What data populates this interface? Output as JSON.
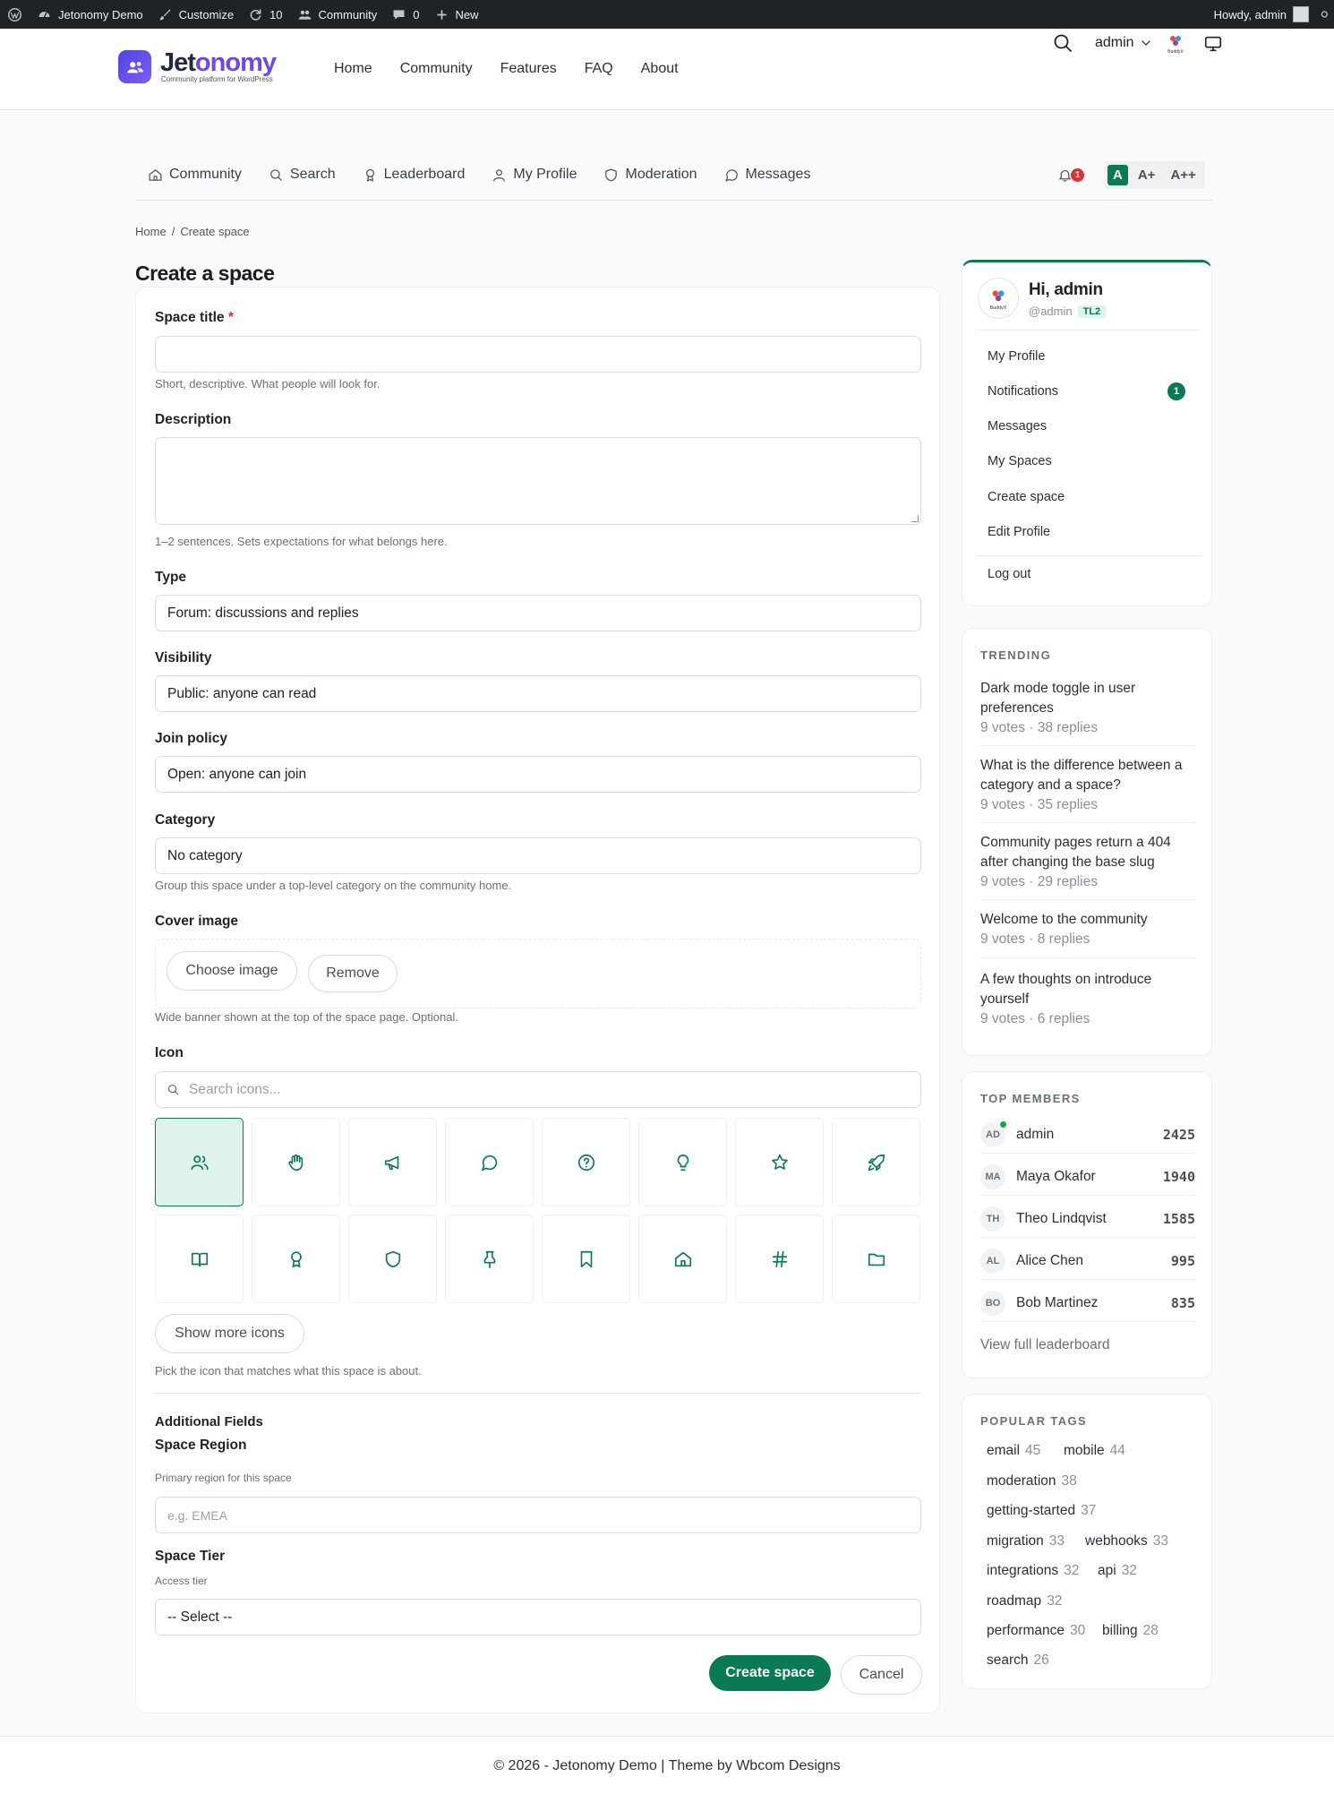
{
  "admin_bar": {
    "site_name": "Jetonomy Demo",
    "customize": "Customize",
    "updates_count": "10",
    "community": "Community",
    "comments_count": "0",
    "new": "New",
    "howdy": "Howdy, admin"
  },
  "header": {
    "logo_name_a": "Jet",
    "logo_name_b": "onomy",
    "logo_tagline": "Community platform for WordPress",
    "nav": [
      "Home",
      "Community",
      "Features",
      "FAQ",
      "About"
    ],
    "user_label": "admin",
    "avatar_label": "BuddyX"
  },
  "community_nav": {
    "items": [
      "Community",
      "Search",
      "Leaderboard",
      "My Profile",
      "Moderation",
      "Messages"
    ],
    "notification_count": "1",
    "font_sizes": [
      "A",
      "A+",
      "A++"
    ]
  },
  "breadcrumb": {
    "home": "Home",
    "sep": "/",
    "current": "Create space"
  },
  "page_title": "Create a space",
  "form": {
    "title_label": "Space title",
    "required_mark": "*",
    "title_value": "",
    "title_help": "Short, descriptive. What people will look for.",
    "description_label": "Description",
    "description_value": "",
    "description_help": "1–2 sentences. Sets expectations for what belongs here.",
    "type_label": "Type",
    "type_value": "Forum: discussions and replies",
    "visibility_label": "Visibility",
    "visibility_value": "Public: anyone can read",
    "join_label": "Join policy",
    "join_value": "Open: anyone can join",
    "category_label": "Category",
    "category_value": "No category",
    "category_help": "Group this space under a top-level category on the community home.",
    "cover_label": "Cover image",
    "choose_image": "Choose image",
    "remove": "Remove",
    "cover_help": "Wide banner shown at the top of the space page. Optional.",
    "icon_label": "Icon",
    "icon_search_placeholder": "Search icons...",
    "icons": [
      "users-icon",
      "hand-icon",
      "megaphone-icon",
      "chat-icon",
      "help-circle-icon",
      "lightbulb-icon",
      "star-icon",
      "rocket-icon",
      "book-icon",
      "award-icon",
      "shield-icon",
      "pin-icon",
      "bookmark-icon",
      "home-icon",
      "hash-icon",
      "folder-icon"
    ],
    "selected_icon": "users-icon",
    "show_more_icons": "Show more icons",
    "icon_help": "Pick the icon that matches what this space is about.",
    "additional_fields": "Additional Fields",
    "region_label": "Space Region",
    "region_help": "Primary region for this space",
    "region_placeholder": "e.g. EMEA",
    "tier_label": "Space Tier",
    "tier_help": "Access tier",
    "tier_value": "-- Select --",
    "submit": "Create space",
    "cancel": "Cancel"
  },
  "user_card": {
    "greeting": "Hi, admin",
    "handle": "@admin",
    "trust_level": "TL2",
    "avatar_label": "BuddyX",
    "menu": [
      "My Profile",
      "Notifications",
      "Messages",
      "My Spaces",
      "Create space",
      "Edit Profile"
    ],
    "notifications_count": "1",
    "logout": "Log out"
  },
  "trending": {
    "title": "TRENDING",
    "items": [
      {
        "title": "Dark mode toggle in user preferences",
        "meta": "9 votes · 38 replies"
      },
      {
        "title": "What is the difference between a category and a space?",
        "meta": "9 votes · 35 replies"
      },
      {
        "title": "Community pages return a 404 after changing the base slug",
        "meta": "9 votes · 29 replies"
      },
      {
        "title": "Welcome to the community",
        "meta": "9 votes · 8 replies"
      },
      {
        "title": "A few thoughts on introduce yourself",
        "meta": "9 votes · 6 replies"
      }
    ]
  },
  "top_members": {
    "title": "TOP MEMBERS",
    "members": [
      {
        "initials": "AD",
        "name": "admin",
        "score": "2425"
      },
      {
        "initials": "MA",
        "name": "Maya Okafor",
        "score": "1940"
      },
      {
        "initials": "TH",
        "name": "Theo Lindqvist",
        "score": "1585"
      },
      {
        "initials": "AL",
        "name": "Alice Chen",
        "score": "995"
      },
      {
        "initials": "BO",
        "name": "Bob Martinez",
        "score": "835"
      }
    ],
    "link": "View full leaderboard"
  },
  "popular_tags": {
    "title": "POPULAR TAGS",
    "tags": [
      {
        "name": "email",
        "count": "45"
      },
      {
        "name": "mobile",
        "count": "44"
      },
      {
        "name": "moderation",
        "count": "38"
      },
      {
        "name": "getting-started",
        "count": "37"
      },
      {
        "name": "migration",
        "count": "33"
      },
      {
        "name": "webhooks",
        "count": "33"
      },
      {
        "name": "integrations",
        "count": "32"
      },
      {
        "name": "api",
        "count": "32"
      },
      {
        "name": "roadmap",
        "count": "32"
      },
      {
        "name": "performance",
        "count": "30"
      },
      {
        "name": "billing",
        "count": "28"
      },
      {
        "name": "search",
        "count": "26"
      }
    ]
  },
  "footer": {
    "text": "© 2026 - Jetonomy Demo | Theme by Wbcom Designs"
  },
  "colors": {
    "accent": "#0a7a55",
    "danger": "#d63638",
    "brand": "#6d4ae6"
  }
}
